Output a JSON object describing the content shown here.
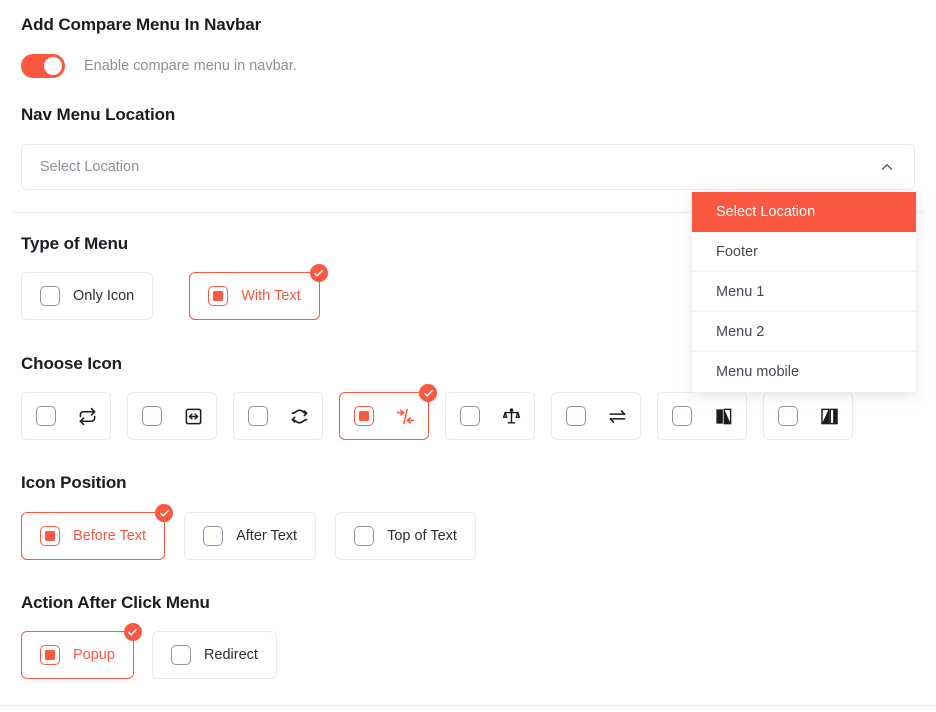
{
  "sections": {
    "navbar": {
      "title": "Add Compare Menu In Navbar",
      "toggle": {
        "label": "Enable compare menu in navbar.",
        "state": "on",
        "color": "#FB5842"
      }
    },
    "nav_menu_location": {
      "title": "Nav Menu Location",
      "select": {
        "placeholder": "Select Location",
        "value": "",
        "expanded": true,
        "chevron": "chevron-up-icon",
        "options": [
          {
            "label": "Select Location",
            "selected": true
          },
          {
            "label": "Footer",
            "selected": false
          },
          {
            "label": "Menu 1",
            "selected": false
          },
          {
            "label": "Menu 2",
            "selected": false
          },
          {
            "label": "Menu mobile",
            "selected": false
          }
        ]
      }
    },
    "type_of_menu": {
      "title": "Type of Menu",
      "options": [
        {
          "label": "Only Icon",
          "selected": false
        },
        {
          "label": "With Text",
          "selected": true
        }
      ]
    },
    "choose_icon": {
      "title": "Choose Icon",
      "options": [
        {
          "icon": "repeat-arrows-icon",
          "selected": false
        },
        {
          "icon": "box-arrows-icon",
          "selected": false
        },
        {
          "icon": "wavy-swap-arrows-icon",
          "selected": false
        },
        {
          "icon": "arrows-to-center-icon",
          "selected": true
        },
        {
          "icon": "balance-scale-icon",
          "selected": false
        },
        {
          "icon": "exchange-arrows-icon",
          "selected": false
        },
        {
          "icon": "split-square-filled-icon",
          "selected": false
        },
        {
          "icon": "split-square-outline-icon",
          "selected": false
        }
      ]
    },
    "icon_position": {
      "title": "Icon Position",
      "options": [
        {
          "label": "Before Text",
          "selected": true
        },
        {
          "label": "After Text",
          "selected": false
        },
        {
          "label": "Top of Text",
          "selected": false
        }
      ]
    },
    "action_after_click": {
      "title": "Action After Click Menu",
      "options": [
        {
          "label": "Popup",
          "selected": true
        },
        {
          "label": "Redirect",
          "selected": false
        }
      ]
    }
  },
  "theme": {
    "accent": "#FB5842",
    "border": "#e7eaef",
    "muted": "#8a8f98"
  }
}
